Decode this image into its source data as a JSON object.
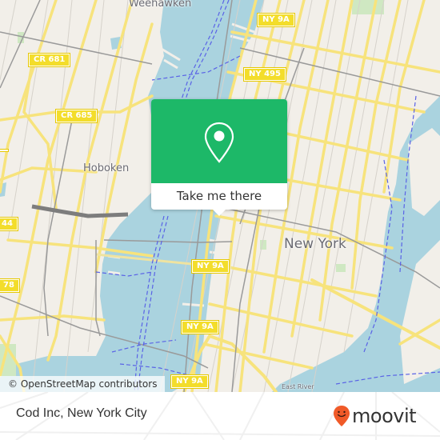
{
  "map": {
    "colors": {
      "water": "#aad3df",
      "land": "#f2efe9",
      "major_road": "#f7e37c",
      "rail": "#9a9a9a",
      "ferry": "#5a63e6",
      "park": "#cfe8c2",
      "popup_green": "#1db868",
      "shield": "#f3dd2b",
      "moovit_orange": "#f05a28"
    },
    "place_labels": {
      "weehawken": "Weehawken",
      "hoboken": "Hoboken",
      "new_york": "New York",
      "east_river": "East River"
    },
    "route_shields": {
      "cr681": "CR 681",
      "cr685": "CR 685",
      "ny9a_top": "NY 9A",
      "ny495": "NY 495",
      "ny9a_mid": "NY 9A",
      "ny9a_lower": "NY 9A",
      "ny9a_bottom": "NY 9A",
      "left_edge_44": "44",
      "left_edge_78": "78",
      "left_edge_partial": ""
    },
    "attribution": "© OpenStreetMap contributors"
  },
  "popup": {
    "icon": "location-pin-icon",
    "cta_label": "Take me there"
  },
  "footer": {
    "place_name": "Cod Inc, New York City",
    "brand": "moovit",
    "brand_icon": "moovit-smile-pin-icon"
  }
}
